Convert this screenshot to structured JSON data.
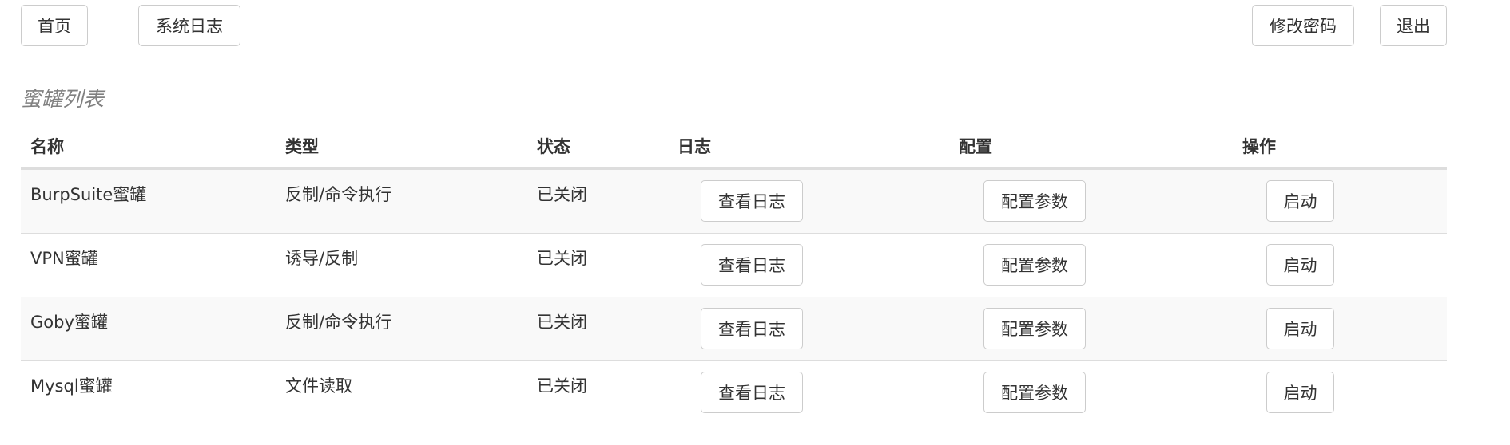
{
  "nav": {
    "home": "首页",
    "system_log": "系统日志",
    "change_password": "修改密码",
    "logout": "退出"
  },
  "section_title": "蜜罐列表",
  "table": {
    "headers": {
      "name": "名称",
      "type": "类型",
      "status": "状态",
      "log": "日志",
      "config": "配置",
      "action": "操作"
    },
    "rows": [
      {
        "name": "BurpSuite蜜罐",
        "type": "反制/命令执行",
        "status": "已关闭",
        "log_button": "查看日志",
        "config_button": "配置参数",
        "action_button": "启动"
      },
      {
        "name": "VPN蜜罐",
        "type": "诱导/反制",
        "status": "已关闭",
        "log_button": "查看日志",
        "config_button": "配置参数",
        "action_button": "启动"
      },
      {
        "name": "Goby蜜罐",
        "type": "反制/命令执行",
        "status": "已关闭",
        "log_button": "查看日志",
        "config_button": "配置参数",
        "action_button": "启动"
      },
      {
        "name": "Mysql蜜罐",
        "type": "文件读取",
        "status": "已关闭",
        "log_button": "查看日志",
        "config_button": "配置参数",
        "action_button": "启动"
      }
    ]
  }
}
